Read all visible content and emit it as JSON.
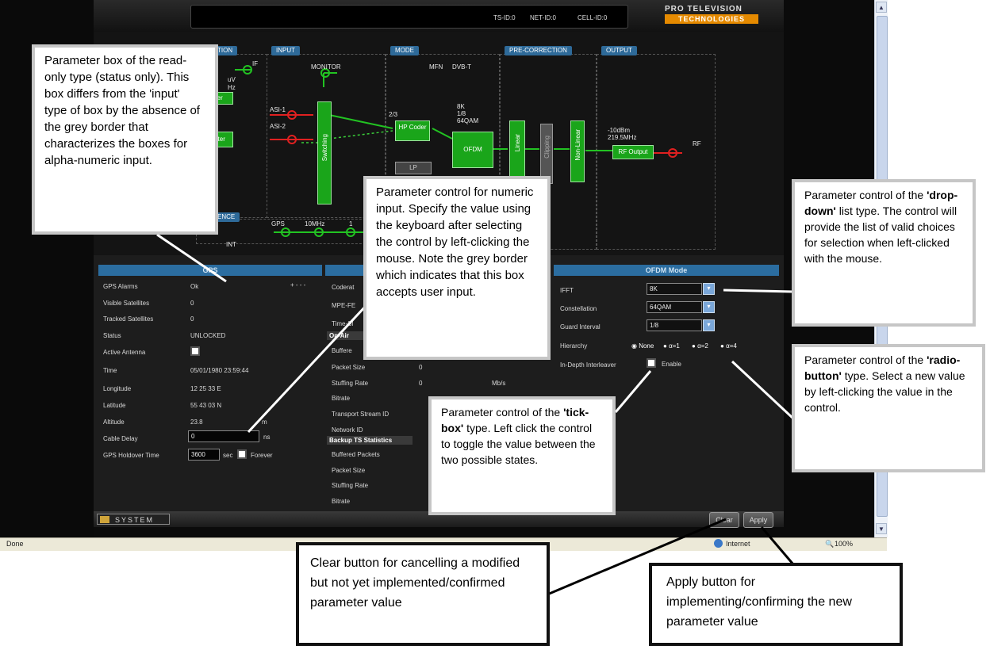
{
  "header": {
    "ts_id": "TS-ID:0",
    "net_id": "NET-ID:0",
    "cell_id": "CELL-ID:0",
    "brand_line1": "PRO TELEVISION",
    "brand_line2": "TECHNOLOGIES"
  },
  "diagram": {
    "stages": {
      "reception": "TION",
      "input": "INPUT",
      "mode": "MODE",
      "precorrection": "PRE-CORRECTION",
      "output": "OUTPUT",
      "reference": "ENCE"
    },
    "monitor": "MONITOR",
    "if": "IF",
    "uv": "uV",
    "hz": "Hz",
    "asi1": "ASI-1",
    "asi2": "ASI-2",
    "mode_mfn": "MFN",
    "mode_dvbt": "DVB-T",
    "rate": "2/3",
    "fft": "8K",
    "guard": "1/8",
    "qam": "64QAM",
    "hp_coder": "HP Coder",
    "lp": "LP",
    "ofdm": "OFDM",
    "switching": "Switching",
    "linear": "Linear",
    "clipping": "Clipping",
    "nonlinear": "Non-Linear",
    "out_level": "-10dBm",
    "out_freq": "219.5MHz",
    "rf_output": "RF Output",
    "rf": "RF",
    "tuner": "ner",
    "filter": "Filter",
    "int": "INT",
    "gps": "GPS",
    "mhz10": "10MHz",
    "one": "1"
  },
  "gps": {
    "title": "GPS",
    "alarms_label": "GPS Alarms",
    "alarms_value": "Ok",
    "alarms_more": "+ - - -",
    "visible_label": "Visible Satellites",
    "visible_value": "0",
    "tracked_label": "Tracked Satellites",
    "tracked_value": "0",
    "status_label": "Status",
    "status_value": "UNLOCKED",
    "antenna_label": "Active Antenna",
    "time_label": "Time",
    "time_value": "05/01/1980 23:59:44",
    "longitude_label": "Longitude",
    "longitude_value": "12 25 33 E",
    "latitude_label": "Latitude",
    "latitude_value": "55 43 03 N",
    "altitude_label": "Altitude",
    "altitude_value": "23.8",
    "altitude_unit": "m",
    "cable_label": "Cable Delay",
    "cable_value": "0",
    "cable_unit": "ns",
    "holdover_label": "GPS Holdover Time",
    "holdover_value": "3600",
    "holdover_unit": "sec",
    "forever_label": "Forever"
  },
  "middle": {
    "coderate_label": "Coderat",
    "mpefe_label": "MPE-FE",
    "timesl_label": "Time-Sl",
    "onair_section": "On-Air",
    "buffered_label": "Buffere",
    "packet_size_label": "Packet Size",
    "packet_size_value": "0",
    "stuffing_label": "Stuffing Rate",
    "stuffing_value": "0",
    "stuffing_unit": "Mb/s",
    "bitrate_label": "Bitrate",
    "tsid_label": "Transport Stream ID",
    "netid_label": "Network ID",
    "backup_section": "Backup TS Statistics",
    "b_buffered_label": "Buffered Packets",
    "b_packet_label": "Packet Size",
    "b_stuffing_label": "Stuffing Rate",
    "b_bitrate_label": "Bitrate"
  },
  "ofdm": {
    "title": "OFDM Mode",
    "fft_label": "IFFT",
    "fft_value": "8K",
    "const_label": "Constellation",
    "const_value": "64QAM",
    "guard_label": "Guard Interval",
    "guard_value": "1/8",
    "hier_label": "Hierarchy",
    "hier_none": "None",
    "hier_a1": "α=1",
    "hier_a2": "α=2",
    "hier_a4": "α=4",
    "interleaver_label": "In-Depth Interleaver",
    "enable_label": "Enable"
  },
  "footer": {
    "system": "SYSTEM",
    "clear": "Clear",
    "apply": "Apply"
  },
  "statusbar": {
    "done": "Done",
    "zone": "Internet",
    "zoom": "100%"
  },
  "callouts": {
    "readonly": "Parameter box of the read-only type (status only). This box differs from the 'input' type of box by the absence of the grey border that characterizes the boxes for alpha-numeric input.",
    "numeric": "Parameter control for numeric input. Specify the value using the keyboard after selecting the control by left-clicking the mouse. Note the grey border which indicates that this box accepts user input.",
    "dropdown_pre": "Parameter control of the ",
    "dropdown_bold": "'drop-down'",
    "dropdown_post": " list type. The control will provide the list of valid choices for selection when left-clicked with the mouse.",
    "radio_pre": "Parameter control of the ",
    "radio_bold": "'radio-button'",
    "radio_post": " type. Select a new value by left-clicking the value in the control.",
    "tick_pre": "Parameter control of the ",
    "tick_bold": "'tick-box'",
    "tick_post": " type. Left click the control to toggle the value between the two possible states.",
    "clear": "Clear button for cancelling a modified but not yet implemented/confirmed parameter value",
    "apply": "Apply button for implementing/confirming the new parameter value"
  }
}
